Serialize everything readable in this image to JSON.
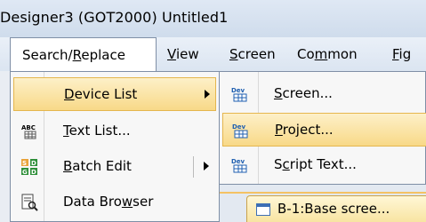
{
  "title": "Designer3 (GOT2000) Untitled1",
  "menubar": {
    "items": [
      {
        "id": "search",
        "label": "Search/Replace",
        "pre": "Search/",
        "mn": "R",
        "post": "eplace"
      },
      {
        "id": "view",
        "label": "View",
        "pre": "",
        "mn": "V",
        "post": "iew"
      },
      {
        "id": "screen",
        "label": "Screen",
        "pre": "",
        "mn": "S",
        "post": "creen"
      },
      {
        "id": "common",
        "label": "Common",
        "pre": "Co",
        "mn": "m",
        "post": "mon"
      },
      {
        "id": "fig",
        "label": "Fig",
        "pre": "",
        "mn": "F",
        "post": "ig"
      }
    ]
  },
  "dropdown": {
    "items": [
      {
        "pre": "",
        "mn": "D",
        "post": "evice List",
        "icon": "none",
        "highlighted": true,
        "has_submenu": true
      },
      {
        "pre": "",
        "mn": "T",
        "post": "ext List...",
        "icon": "abc-list-icon",
        "highlighted": false,
        "has_submenu": false
      },
      {
        "pre": "",
        "mn": "B",
        "post": "atch Edit",
        "icon": "batch-edit-icon",
        "highlighted": false,
        "has_submenu": true
      },
      {
        "pre": "Data Bro",
        "mn": "w",
        "post": "ser",
        "icon": "data-browser-icon",
        "highlighted": false,
        "has_submenu": false
      }
    ]
  },
  "submenu": {
    "items": [
      {
        "pre": "",
        "mn": "S",
        "post": "creen...",
        "icon": "dev-icon",
        "highlighted": false
      },
      {
        "pre": "",
        "mn": "P",
        "post": "roject...",
        "icon": "dev-icon",
        "highlighted": true
      },
      {
        "pre": "S",
        "mn": "c",
        "post": "ript Text...",
        "icon": "dev-icon",
        "highlighted": false
      }
    ]
  },
  "tab": {
    "label": "B-1:Base scree..."
  },
  "colors": {
    "highlight": "#f8d988",
    "highlight_border": "#e5b64e",
    "dev_icon_blue": "#1f5fb0"
  }
}
